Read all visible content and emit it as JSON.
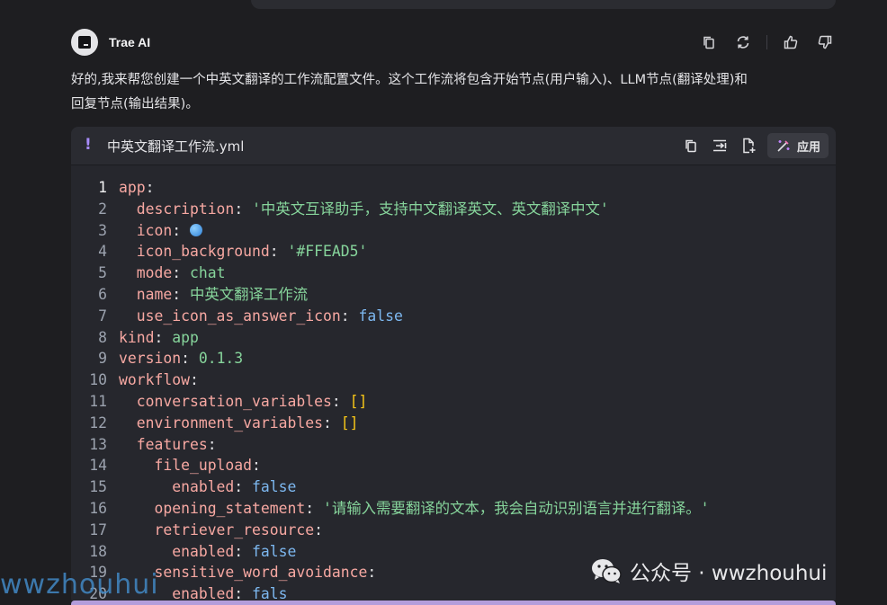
{
  "chat": {
    "assistant_name": "Trae AI",
    "intro_line1": "好的,我来帮您创建一个中英文翻译的工作流配置文件。这个工作流将包含开始节点(用户输入)、LLM节点(翻译处理)和",
    "intro_line2": "回复节点(输出结果)。"
  },
  "header_icons": [
    "copy-icon",
    "refresh-icon",
    "thumbs-up-icon",
    "thumbs-down-icon"
  ],
  "code": {
    "filename": "中英文翻译工作流.yml",
    "file_icon": "!",
    "apply_label": "应用",
    "line_numbers": [
      "1",
      "2",
      "3",
      "4",
      "5",
      "6",
      "7",
      "8",
      "9",
      "10",
      "11",
      "12",
      "13",
      "14",
      "15",
      "16",
      "17",
      "18",
      "19",
      "20"
    ],
    "lines": [
      {
        "indent": "",
        "key": "app",
        "colon": ":"
      },
      {
        "indent": "  ",
        "key": "description",
        "colon": ": ",
        "val": "'中英文互译助手，支持中文翻译英文、英文翻译中文'"
      },
      {
        "indent": "  ",
        "key": "icon",
        "colon": ": "
      },
      {
        "indent": "  ",
        "key": "icon_background",
        "colon": ": ",
        "val": "'#FFEAD5'"
      },
      {
        "indent": "  ",
        "key": "mode",
        "colon": ": ",
        "val": "chat"
      },
      {
        "indent": "  ",
        "key": "name",
        "colon": ": ",
        "val": "中英文翻译工作流"
      },
      {
        "indent": "  ",
        "key": "use_icon_as_answer_icon",
        "colon": ": ",
        "val": "false"
      },
      {
        "indent": "",
        "key": "kind",
        "colon": ": ",
        "val": "app"
      },
      {
        "indent": "",
        "key": "version",
        "colon": ": ",
        "val": "0.1.3"
      },
      {
        "indent": "",
        "key": "workflow",
        "colon": ":"
      },
      {
        "indent": "  ",
        "key": "conversation_variables",
        "colon": ": ",
        "val": "[]"
      },
      {
        "indent": "  ",
        "key": "environment_variables",
        "colon": ": ",
        "val": "[]"
      },
      {
        "indent": "  ",
        "key": "features",
        "colon": ":"
      },
      {
        "indent": "    ",
        "key": "file_upload",
        "colon": ":"
      },
      {
        "indent": "      ",
        "key": "enabled",
        "colon": ": ",
        "val": "false"
      },
      {
        "indent": "    ",
        "key": "opening_statement",
        "colon": ": ",
        "val": "'请输入需要翻译的文本，我会自动识别语言并进行翻译。'"
      },
      {
        "indent": "    ",
        "key": "retriever_resource",
        "colon": ":"
      },
      {
        "indent": "      ",
        "key": "enabled",
        "colon": ": ",
        "val": "false"
      },
      {
        "indent": "    ",
        "key": "sensitive_word_avoidance",
        "colon": ":"
      },
      {
        "indent": "      ",
        "key": "enabled",
        "colon": ": ",
        "val": "fals"
      }
    ]
  },
  "watermark": {
    "left": "wwzhouhui",
    "right": "公众号 · wwzhouhui"
  },
  "colors": {
    "background": "#1e1e21",
    "code_bg": "#26272d",
    "key": "#f7a8a2",
    "string": "#86d49b",
    "boolean": "#7db8f0",
    "bracket": "#f5c518",
    "accent": "#a78bfa"
  }
}
